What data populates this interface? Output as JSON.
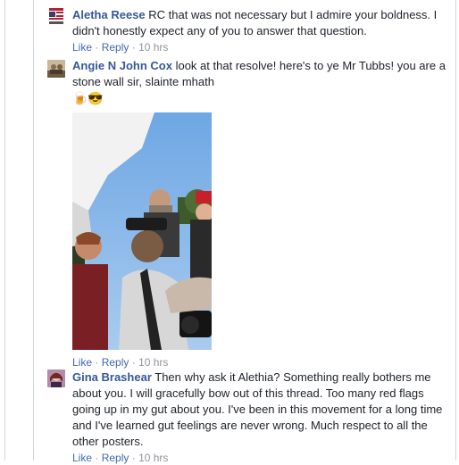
{
  "comments": [
    {
      "author": "Aletha Reese",
      "text": "RC that was not necessary but I admire your boldness. I didn't honestly expect any of you to answer that question.",
      "like_label": "Like",
      "reply_label": "Reply",
      "time": "10 hrs"
    },
    {
      "author": "Angie N John Cox",
      "text": "look at that resolve! here's to ye Mr Tubbs! you are a stone wall sir, slainte mhath",
      "emojis": "🍺😎",
      "like_label": "Like",
      "reply_label": "Reply",
      "time": "10 hrs"
    },
    {
      "author": "Gina Brashear",
      "text": "Then why ask it Alethia? Something really bothers me about you. I will gracefully bow out of this thread. Too many red flags going up in my gut about you. I've been in this movement for a long time and I've learned gut feelings are never wrong. Much respect to all the other posters.",
      "like_label": "Like",
      "reply_label": "Reply",
      "time": "10 hrs"
    }
  ],
  "separator": "·",
  "colors": {
    "link": "#365899",
    "action": "#4267b2",
    "meta": "#90949c",
    "text": "#1d2129",
    "rail": "#d0d6e0"
  }
}
